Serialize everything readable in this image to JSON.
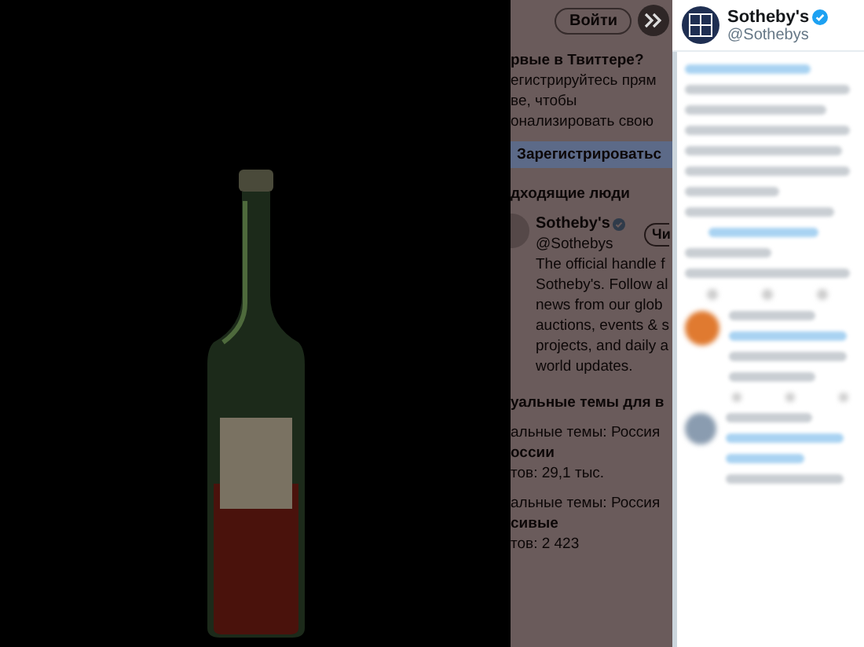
{
  "background_page": {
    "login_button": "Войти",
    "signup": {
      "heading": "рвые в Твиттере?",
      "lines": [
        "егистрируйтесь прям",
        "ве, чтобы",
        "онализировать свою"
      ],
      "button": "Зарегистрироватьс"
    },
    "suggestions": {
      "heading": "дходящие люди",
      "account": {
        "name": "Sotheby's",
        "verified": true,
        "handle": "@Sothebys",
        "follow_button": "Чи",
        "bio": [
          "The official handle f",
          "Sotheby's. Follow al",
          "news from our glob",
          "auctions, events & s",
          "projects, and daily a",
          "world updates."
        ]
      }
    },
    "trends": {
      "heading": "уальные темы для в",
      "items": [
        {
          "context": "альные темы: Россия",
          "name": "оссии",
          "count": "тов: 29,1 тыс."
        },
        {
          "context": "альные темы: Россия",
          "name": "сивые",
          "count": "тов: 2 423"
        }
      ]
    }
  },
  "tweet_panel": {
    "author": {
      "name": "Sotheby's",
      "verified": true,
      "handle": "@Sothebys"
    }
  }
}
